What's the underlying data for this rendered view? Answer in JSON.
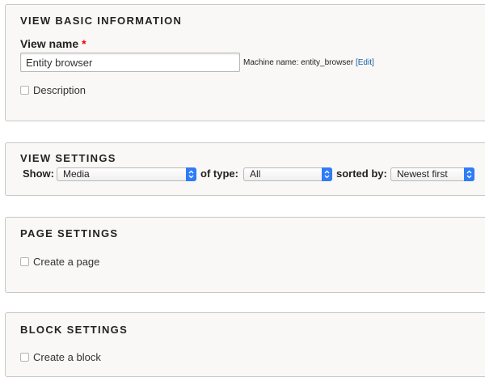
{
  "basic_info": {
    "title": "VIEW BASIC INFORMATION",
    "view_name_label": "View name",
    "required_marker": "*",
    "view_name_value": "Entity browser",
    "machine_name_prefix": "Machine name: entity_browser",
    "edit_link": "[Edit]",
    "description_label": "Description"
  },
  "view_settings": {
    "title": "VIEW SETTINGS",
    "show_label": "Show:",
    "show_value": "Media",
    "type_label": "of type:",
    "type_value": "All",
    "sort_label": "sorted by:",
    "sort_value": "Newest first"
  },
  "page_settings": {
    "title": "PAGE SETTINGS",
    "create_label": "Create a page"
  },
  "block_settings": {
    "title": "BLOCK SETTINGS",
    "create_label": "Create a block"
  },
  "icons": {
    "select_arrow": "chevron-up-down-icon",
    "checkbox": "checkbox-unchecked"
  },
  "colors": {
    "panel_bg": "#f9f8f6",
    "border": "#c9c7c3",
    "accent": "#2f7cf6",
    "link": "#1a5ea8",
    "required": "#ee0000"
  }
}
